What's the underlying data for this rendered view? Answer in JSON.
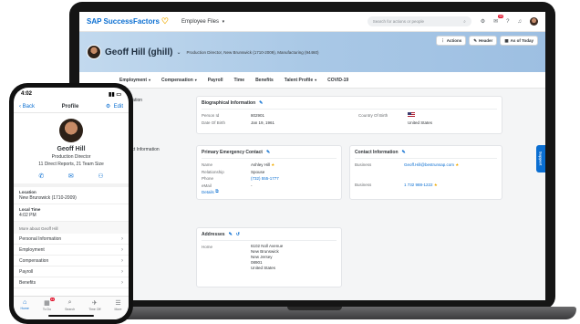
{
  "laptop": {
    "shell": {
      "logo_text": "SAP SuccessFactors",
      "module_label": "Employee Files",
      "search_placeholder": "Search for actions or people",
      "notification_badge": "99"
    },
    "header": {
      "name": "Geoff Hill (ghill)",
      "subtitle": "Production Director, New Brunswick (1710-2009), Manufacturing (94460)",
      "buttons": [
        "Actions",
        "Header",
        "As of Today"
      ]
    },
    "tabs": [
      "Employment",
      "Compensation",
      "Payroll",
      "Time",
      "Benefits",
      "Talent Profile",
      "COVID-19"
    ],
    "section_labels": [
      "Information",
      "Contact Information"
    ],
    "biographical": {
      "title": "Biographical Information",
      "rows": [
        {
          "k": "Person Id",
          "v": "802901"
        },
        {
          "k": "Date Of Birth",
          "v": "Jan 19, 1961"
        }
      ],
      "country_label": "Country Of Birth",
      "country_value": "United States"
    },
    "emergency": {
      "title": "Primary Emergency Contact",
      "rows": [
        {
          "k": "Name",
          "v": "Ashley Hill"
        },
        {
          "k": "Relationship",
          "v": "Spouse"
        },
        {
          "k": "Phone",
          "v": "(732) 555-1777"
        },
        {
          "k": "eMail",
          "v": "-"
        }
      ],
      "details_link": "Details"
    },
    "contact": {
      "title": "Contact Information",
      "email_label": "Business",
      "email_value": "Geoff.Hill@bestrunsap.com",
      "phone_label": "Business",
      "phone_value": "1 732 988-1222"
    },
    "addresses": {
      "title": "Addresses",
      "label": "Home",
      "lines": [
        "6102 Noll Avenue",
        "New Brunswick",
        "New Jersey",
        "08901",
        "United States"
      ]
    },
    "support_tab": "Support"
  },
  "phone": {
    "status_time": "4:02",
    "nav": {
      "back": "Back",
      "title": "Profile",
      "edit": "Edit"
    },
    "profile": {
      "name": "Geoff Hill",
      "title": "Production Director",
      "reports": "11 Direct Reports, 21 Team Size"
    },
    "fields": [
      {
        "label": "Location",
        "value": "New Brunswick (1710-2009)"
      },
      {
        "label": "Local Time",
        "value": "4:02 PM"
      }
    ],
    "more_label": "More about Geoff Hill",
    "items": [
      "Personal Information",
      "Employment",
      "Compensation",
      "Payroll",
      "Benefits"
    ],
    "tabbar": [
      {
        "label": "Home"
      },
      {
        "label": "To Do",
        "badge": "43"
      },
      {
        "label": "Search"
      },
      {
        "label": "Time Off"
      },
      {
        "label": "More"
      }
    ]
  },
  "colors": {
    "accent": "#0a6ed1",
    "star": "#f0ab00",
    "badge": "#e0112b"
  }
}
